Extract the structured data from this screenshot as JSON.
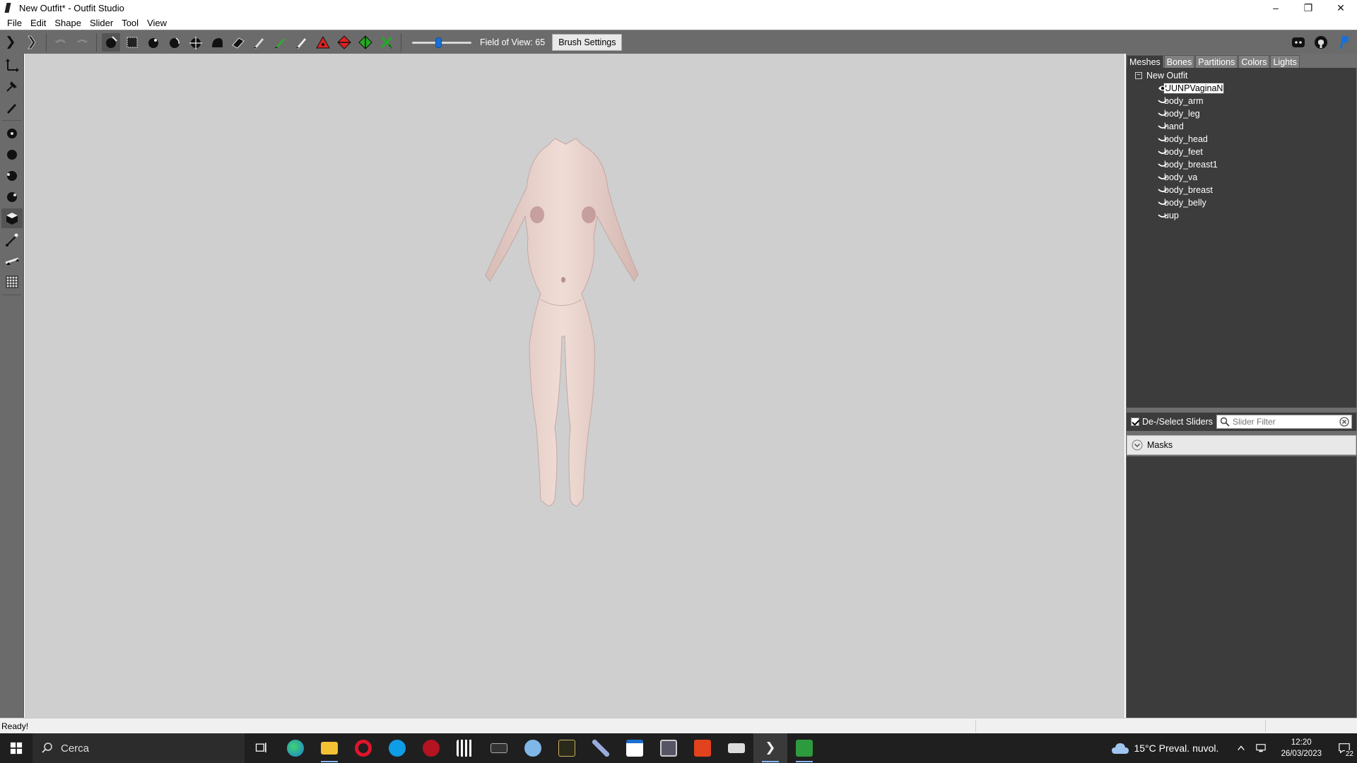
{
  "window": {
    "title": "New Outfit* - Outfit Studio"
  },
  "menu": [
    "File",
    "Edit",
    "Shape",
    "Slider",
    "Tool",
    "View"
  ],
  "toolbar": {
    "fov_label": "Field of View: 65",
    "fov_value": 65,
    "fov_slider_fraction": 0.45,
    "brush_settings_label": "Brush Settings"
  },
  "panel_tabs": [
    "Meshes",
    "Bones",
    "Partitions",
    "Colors",
    "Lights"
  ],
  "mesh_tree": {
    "root": "New Outfit",
    "items": [
      "UUNPVaginaN",
      "body_arm",
      "body_leg",
      "hand",
      "body_head",
      "body_feet",
      "body_breast1",
      "body_va",
      "body_breast",
      "body_belly",
      "uup"
    ]
  },
  "sliders": {
    "deselect_label": "De-/Select Sliders",
    "filter_placeholder": "Slider Filter",
    "masks_label": "Masks"
  },
  "status": {
    "text": "Ready!"
  },
  "taskbar": {
    "search_text": "Cerca",
    "weather": "15°C  Preval. nuvol.",
    "time": "12:20",
    "date": "26/03/2023",
    "notifications": "22"
  },
  "colors": {
    "viewport_bg": "#cfcfcf",
    "toolbar_bg": "#6b6b6b",
    "panel_bg": "#3c3c3c",
    "accent": "#1a6fd6"
  }
}
